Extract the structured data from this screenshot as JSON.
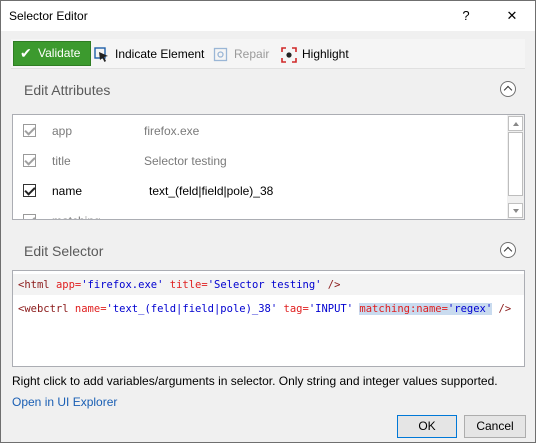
{
  "window": {
    "title": "Selector Editor",
    "help_label": "?",
    "close_label": "✕"
  },
  "toolbar": {
    "validate_label": "Validate",
    "indicate_label": "Indicate Element",
    "repair_label": "Repair",
    "highlight_label": "Highlight",
    "validate_color": "#3c9a2e"
  },
  "edit_attributes": {
    "title": "Edit Attributes",
    "rows": [
      {
        "name": "app",
        "value": "firefox.exe",
        "checked": true,
        "disabled": true
      },
      {
        "name": "title",
        "value": "Selector testing",
        "checked": true,
        "disabled": true
      },
      {
        "name": "name",
        "value": "text_(feld|field|pole)_38",
        "checked": true,
        "disabled": false
      },
      {
        "name": "matching",
        "value": "",
        "checked": true,
        "disabled": true
      }
    ]
  },
  "edit_selector": {
    "title": "Edit Selector",
    "line1": {
      "open": "<html ",
      "attr1_name": "app=",
      "attr1_value": "'firefox.exe'",
      "attr2_name": " title=",
      "attr2_value": "'Selector testing'",
      "close": " />"
    },
    "line2": {
      "open": "<webctrl ",
      "attr1_name": "name=",
      "attr1_value": "'text_(feld|field|pole)_38'",
      "attr2_name": " tag=",
      "attr2_value": "'INPUT'",
      "attr3_name": "matching:name=",
      "attr3_value": "'regex'",
      "close": " />"
    }
  },
  "footer": {
    "note": "Right click to add variables/arguments in selector. Only string and integer values supported.",
    "link": "Open in UI Explorer",
    "ok_label": "OK",
    "cancel_label": "Cancel"
  }
}
